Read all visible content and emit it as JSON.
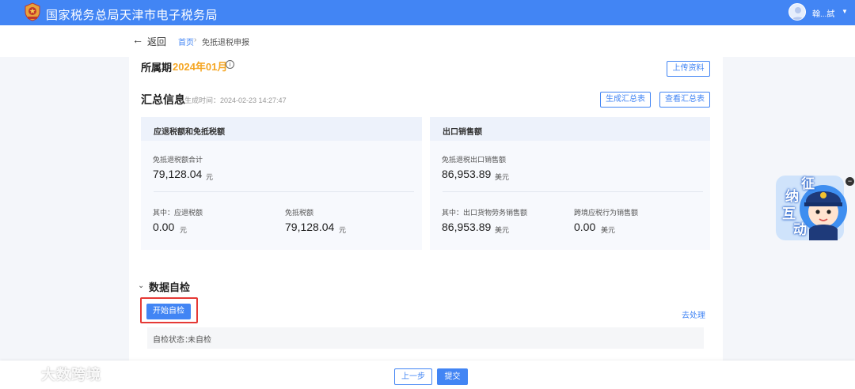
{
  "header": {
    "title": "国家税务总局天津市电子税务局",
    "username": "翰...試",
    "caret": "▼"
  },
  "nav": {
    "back_arrow": "←",
    "back": "返回",
    "breadcrumb_home": "首页",
    "breadcrumb_sep": "›",
    "breadcrumb_current": "免抵退税申报"
  },
  "period": {
    "label": "所属期",
    "value": "2024年01月",
    "info_glyph": "i"
  },
  "buttons": {
    "upload": "上传资料",
    "generate_summary": "生成汇总表",
    "view_summary": "查看汇总表",
    "start_check": "开始自检",
    "goto_process": "去处理",
    "prev": "上一步",
    "submit": "提交"
  },
  "summary": {
    "title": "汇总信息",
    "generated_time": "生成时间：2024-02-23 14:27:47"
  },
  "left_card": {
    "header": "应退税额和免抵税额",
    "total_label": "免抵退税额合计",
    "total_value": "79,128.04",
    "total_unit": "元",
    "refund_label": "其中：应退税额",
    "refund_value": "0.00",
    "refund_unit": "元",
    "exempt_label": "免抵税额",
    "exempt_value": "79,128.04",
    "exempt_unit": "元"
  },
  "right_card": {
    "header": "出口销售额",
    "total_label": "免抵退税出口销售额",
    "total_value": "86,953.89",
    "total_unit": "美元",
    "goods_label": "其中：出口货物劳务销售额",
    "goods_value": "86,953.89",
    "goods_unit": "美元",
    "crossborder_label": "跨境应税行为销售额",
    "crossborder_value": "0.00",
    "crossborder_unit": "美元"
  },
  "self_check": {
    "chevron": "⌄",
    "title": "数据自检",
    "status_label": "自检状态：",
    "status_value": "未自检"
  },
  "mascot": {
    "chars": [
      "征",
      "纳",
      "互",
      "动"
    ]
  },
  "side_toggle": "−",
  "watermark": "大数跨境",
  "colors": {
    "primary": "#4285f4",
    "period_accent": "#f5a623",
    "highlight": "#e53935"
  }
}
